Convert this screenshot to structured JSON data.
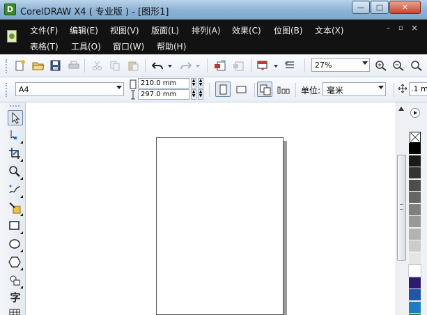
{
  "window": {
    "app_icon_glyph": "D",
    "title": "CorelDRAW X4 ( 专业版 ) - [图形1]",
    "min_glyph": "—",
    "max_glyph": "□",
    "close_glyph": "✕"
  },
  "menu": {
    "row1": [
      "文件(F)",
      "编辑(E)",
      "视图(V)",
      "版面(L)",
      "排列(A)",
      "效果(C)",
      "位图(B)",
      "文本(X)"
    ],
    "row2": [
      "表格(T)",
      "工具(O)",
      "窗口(W)",
      "帮助(H)"
    ],
    "mdi": {
      "min": "–",
      "restore": "▫",
      "close": "×"
    }
  },
  "toolbar": {
    "zoom_value": "27%",
    "icons": [
      "new-document-icon",
      "open-icon",
      "save-icon",
      "print-icon",
      "cut-icon",
      "copy-icon",
      "paste-icon",
      "undo-icon",
      "redo-icon",
      "import-icon",
      "export-icon",
      "application-launcher-icon",
      "welcome-screen-icon",
      "zoom-in-icon",
      "zoom-out-icon",
      "zoom-to-page-icon"
    ]
  },
  "property_bar": {
    "page_size": "A4",
    "width": "210.0 mm",
    "height": "297.0 mm",
    "unit_label": "单位:",
    "unit_value": "毫米",
    "nudge_value": ".1 m"
  },
  "toolbox": {
    "text_tool_glyph": "字",
    "tools": [
      "pick-tool",
      "shape-tool",
      "crop-tool",
      "zoom-tool",
      "freehand-tool",
      "smart-fill-tool",
      "rectangle-tool",
      "ellipse-tool",
      "polygon-tool",
      "basic-shapes-tool",
      "text-tool",
      "table-tool"
    ]
  },
  "palette": {
    "colors": [
      "#000000",
      "#1a1a1a",
      "#333333",
      "#4d4d4d",
      "#666666",
      "#808080",
      "#999999",
      "#b3b3b3",
      "#cccccc",
      "#e6e6e6",
      "#ffffff",
      "#2e1a6e",
      "#1f57a6",
      "#1b7ec2",
      "#1a8a4a"
    ]
  }
}
